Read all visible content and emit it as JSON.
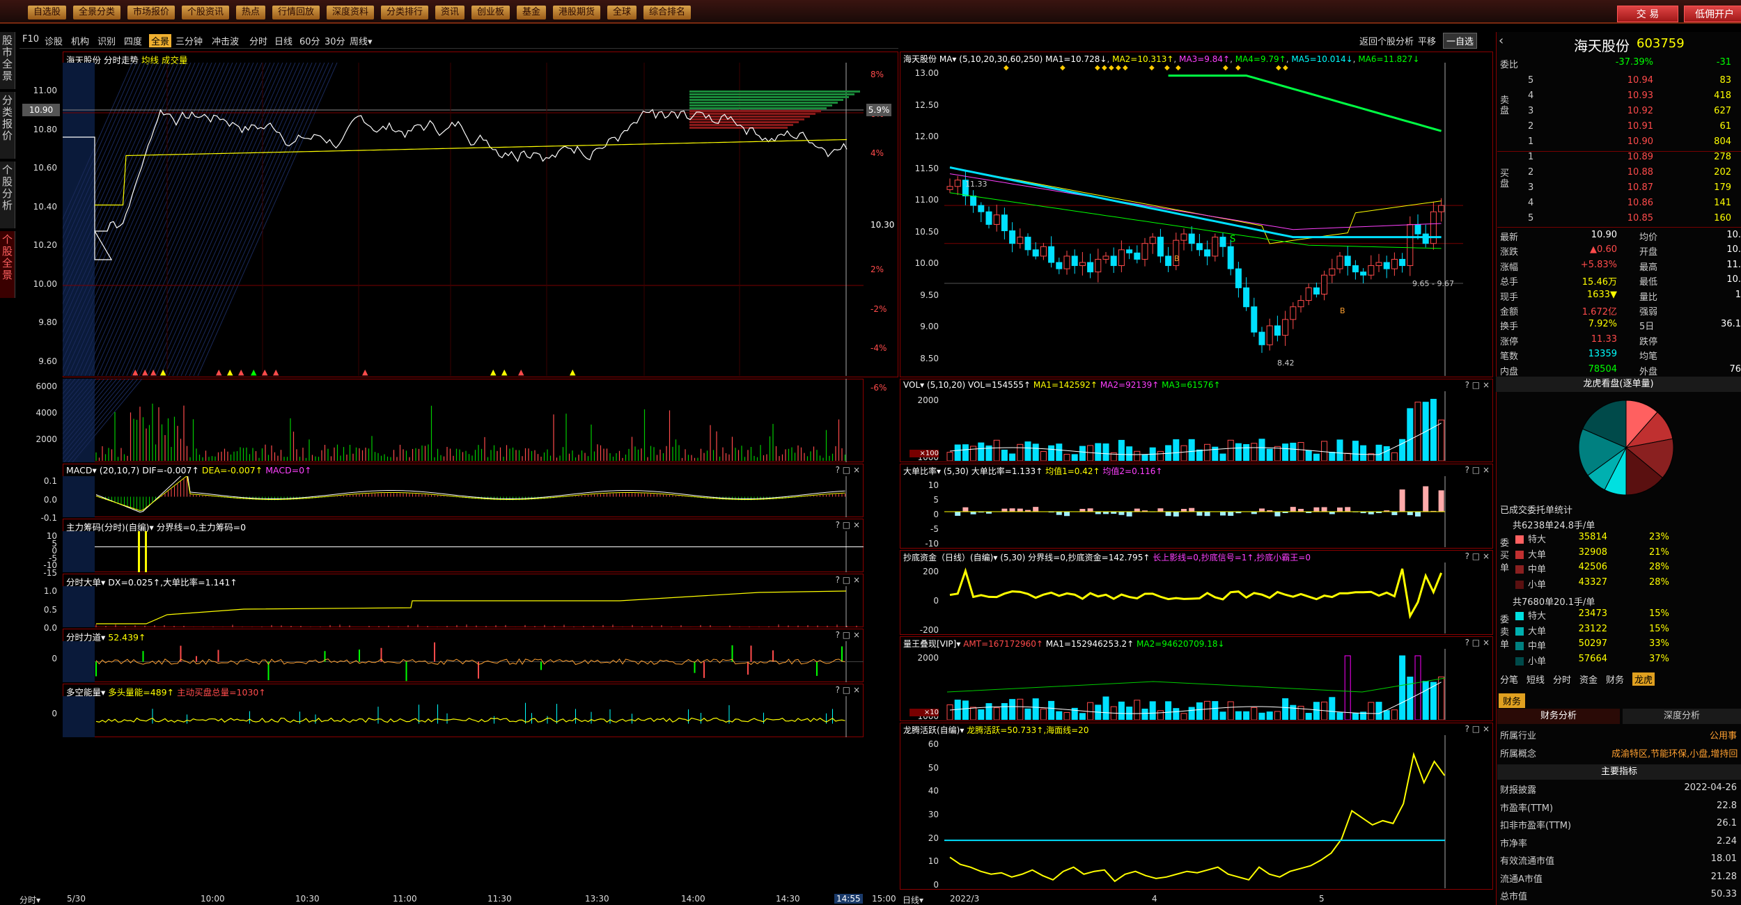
{
  "menu": {
    "items": [
      "自选股",
      "全景分类",
      "市场报价",
      "个股资讯",
      "热点",
      "行情回放",
      "深度资料",
      "分类排行",
      "资讯",
      "创业板",
      "基金",
      "港股期货",
      "全球",
      "综合排名"
    ],
    "trade": "交 易",
    "open": "低佣开户"
  },
  "sidebar": {
    "tabs": [
      "股市全景",
      "分类报价",
      "个股分析",
      "个股全景"
    ]
  },
  "toolbar": {
    "items": [
      "F10",
      "诊股",
      "机构",
      "识别",
      "四度",
      "全景",
      "三分钟",
      "冲击波",
      "分时",
      "日线",
      "60分",
      "30分",
      "周线▾"
    ],
    "right": [
      "返回个股分析",
      "平移",
      "一自选"
    ]
  },
  "stock": {
    "name": "海天股份",
    "code": "603759"
  },
  "intraday": {
    "title": "海天股份 分时走势",
    "title_extra": "均线 成交量",
    "price_ticks": [
      "11.00",
      "10.80",
      "10.60",
      "10.40",
      "10.20",
      "10.00",
      "9.80",
      "9.60"
    ],
    "current_price": "10.90",
    "pct_ticks": [
      "8%",
      "6%",
      "4%",
      "2%",
      "-2%",
      "-4%",
      "-6%"
    ],
    "prev_close": "10.30",
    "current_pct": "5.9%",
    "vol_ticks": [
      "6000",
      "4000",
      "2000"
    ],
    "macd": {
      "label": "MACD▾",
      "params": "(20,10,7)",
      "dif": "DIF=-0.007↑",
      "dea": "DEA=-0.007↑",
      "macd": "MACD=0↑",
      "ticks": [
        "0.1",
        "0.0",
        "-0.1"
      ]
    },
    "chip": {
      "label": "主力筹码(分时)(自编)▾",
      "text": "分界线=0,主力筹码=0",
      "ticks": [
        "10",
        "5",
        "0",
        "-5",
        "-10",
        "-15"
      ]
    },
    "bigorder": {
      "label": "分时大单▾",
      "text": "DX=0.025↑,大单比率=1.141↑",
      "ticks": [
        "1.0",
        "0.5",
        "0.0"
      ]
    },
    "force": {
      "label": "分时力道▾",
      "text": "52.439↑",
      "ticks": [
        "0"
      ]
    },
    "ls": {
      "label": "多空能量▾",
      "text": "多头量能=489↑",
      "text2": "主动买盘总量=1030↑",
      "ticks": [
        "0"
      ]
    },
    "time_ticks": [
      "5/30",
      "10:00",
      "10:30",
      "11:00",
      "11:30",
      "13:30",
      "14:00",
      "14:30",
      "14:55",
      "15:00"
    ],
    "bottom_left": "分时▾"
  },
  "daily": {
    "title": "海天股份",
    "ma_label": "MA▾",
    "ma_params": "(5,10,20,30,60,250)",
    "ma": [
      "MA1=10.728↓",
      "MA2=10.313↑",
      "MA3=9.84↑",
      "MA4=9.79↑",
      "MA5=10.014↓",
      "MA6=11.827↓"
    ],
    "price_ticks": [
      "13.00",
      "12.50",
      "12.00",
      "11.50",
      "11.00",
      "10.50",
      "10.00",
      "9.50",
      "9.00",
      "8.50"
    ],
    "annots": [
      "11.33",
      "8.42",
      "9.65",
      "9.67",
      "S",
      "B"
    ],
    "vol": {
      "label": "VOL▾",
      "params": "(5,10,20)",
      "text": "VOL=154555↑",
      "ma": [
        "MA1=142592↑",
        "MA2=92139↑",
        "MA3=61576↑"
      ],
      "ticks": [
        "2000",
        "1000"
      ],
      "unit": "×100"
    },
    "dbr": {
      "label": "大单比率▾",
      "params": "(5,30)",
      "text": "大单比率=1.133↑",
      "v1": "均值1=0.42↑",
      "v2": "均值2=0.116↑",
      "ticks": [
        "10",
        "5",
        "0",
        "-5",
        "-10"
      ]
    },
    "cdf": {
      "label": "抄底资金（日线）(自编)▾",
      "params": "(5,30)",
      "text": "分界线=0,抄底资金=142.795↑",
      "text2": "长上影线=0,抄底信号=1↑,抄底小霸王=0",
      "ticks": [
        "200",
        "0",
        "-200"
      ]
    },
    "lw": {
      "label": "量王叠现[VIP]▾",
      "amt": "AMT=167172960↑",
      "ma1": "MA1=152946253.2↑",
      "ma2": "MA2=94620709.18↓",
      "ticks": [
        "2000",
        "1000"
      ],
      "unit": "×10"
    },
    "lt": {
      "label": "龙腾活跃(自编)▾",
      "text": "龙腾活跃=50.733↑,海面线=20",
      "ticks": [
        "60",
        "50",
        "40",
        "30",
        "20",
        "10",
        "0"
      ]
    },
    "date_ticks": [
      "2022/3",
      "4",
      "5"
    ],
    "bottom_left": "日线▾"
  },
  "quote": {
    "header": "海天股份",
    "code": "603759",
    "wb_label": "委比",
    "wb": "-37.39%",
    "wb_diff": "-31",
    "asks": [
      {
        "l": "5",
        "p": "10.94",
        "v": "83"
      },
      {
        "l": "4",
        "p": "10.93",
        "v": "418"
      },
      {
        "l": "3",
        "p": "10.92",
        "v": "627"
      },
      {
        "l": "2",
        "p": "10.91",
        "v": "61"
      },
      {
        "l": "1",
        "p": "10.90",
        "v": "804"
      }
    ],
    "bids": [
      {
        "l": "1",
        "p": "10.89",
        "v": "278"
      },
      {
        "l": "2",
        "p": "10.88",
        "v": "202"
      },
      {
        "l": "3",
        "p": "10.87",
        "v": "179"
      },
      {
        "l": "4",
        "p": "10.86",
        "v": "141"
      },
      {
        "l": "5",
        "p": "10.85",
        "v": "160"
      }
    ],
    "ask_side": "卖盘",
    "bid_side": "买盘",
    "stats": [
      [
        "最新",
        "10.90",
        "均价",
        "10."
      ],
      [
        "涨跌",
        "▲0.60",
        "开盘",
        "10."
      ],
      [
        "涨幅",
        "+5.83%",
        "最高",
        "11."
      ],
      [
        "总手",
        "15.46万",
        "最低",
        "10."
      ],
      [
        "现手",
        "1633▼",
        "量比",
        "1"
      ],
      [
        "金额",
        "1.672亿",
        "强弱",
        ""
      ],
      [
        "换手",
        "7.92%",
        "5日",
        "36.1"
      ],
      [
        "涨停",
        "11.33",
        "跌停",
        ""
      ],
      [
        "笔数",
        "13359",
        "均笔",
        ""
      ],
      [
        "内盘",
        "78504",
        "外盘",
        "76"
      ]
    ],
    "pie_title": "龙虎看盘(逐单量)",
    "entrust_title": "已成交委托单统计",
    "buy_total": "共6238单24.8手/单",
    "buy": [
      [
        "特大",
        "35814",
        "23%"
      ],
      [
        "大单",
        "32908",
        "21%"
      ],
      [
        "中单",
        "42506",
        "28%"
      ],
      [
        "小单",
        "43327",
        "28%"
      ]
    ],
    "buy_side": "委买单",
    "sell_total": "共7680单20.1手/单",
    "sell": [
      [
        "特大",
        "23473",
        "15%"
      ],
      [
        "大单",
        "23122",
        "15%"
      ],
      [
        "中单",
        "50297",
        "33%"
      ],
      [
        "小单",
        "57664",
        "37%"
      ]
    ],
    "sell_side": "委卖单",
    "tabs": [
      "分笔",
      "短线",
      "分时",
      "资金",
      "财务",
      "龙虎"
    ],
    "fin_tab": "财务",
    "fin_sub": [
      "财务分析",
      "深度分析"
    ],
    "industry_label": "所属行业",
    "industry": "公用事",
    "concept_label": "所属概念",
    "concept": "成渝特区,节能环保,小盘,增持回",
    "main_idx": "主要指标",
    "rows": [
      [
        "财报披露",
        "2022-04-26"
      ],
      [
        "市盈率(TTM)",
        "22.8"
      ],
      [
        "扣非市盈率(TTM)",
        "26.1"
      ],
      [
        "市净率",
        "2.24"
      ],
      [
        "有效流通市值",
        "18.01"
      ],
      [
        "流通A市值",
        "21.28"
      ],
      [
        "总市值",
        "50.33"
      ]
    ]
  },
  "colors": {
    "red": "#ff4b4b",
    "green": "#00ff00",
    "cyan": "#00e0ff",
    "yellow": "#ffff00",
    "magenta": "#ff40ff",
    "frame": "#8b0000"
  }
}
